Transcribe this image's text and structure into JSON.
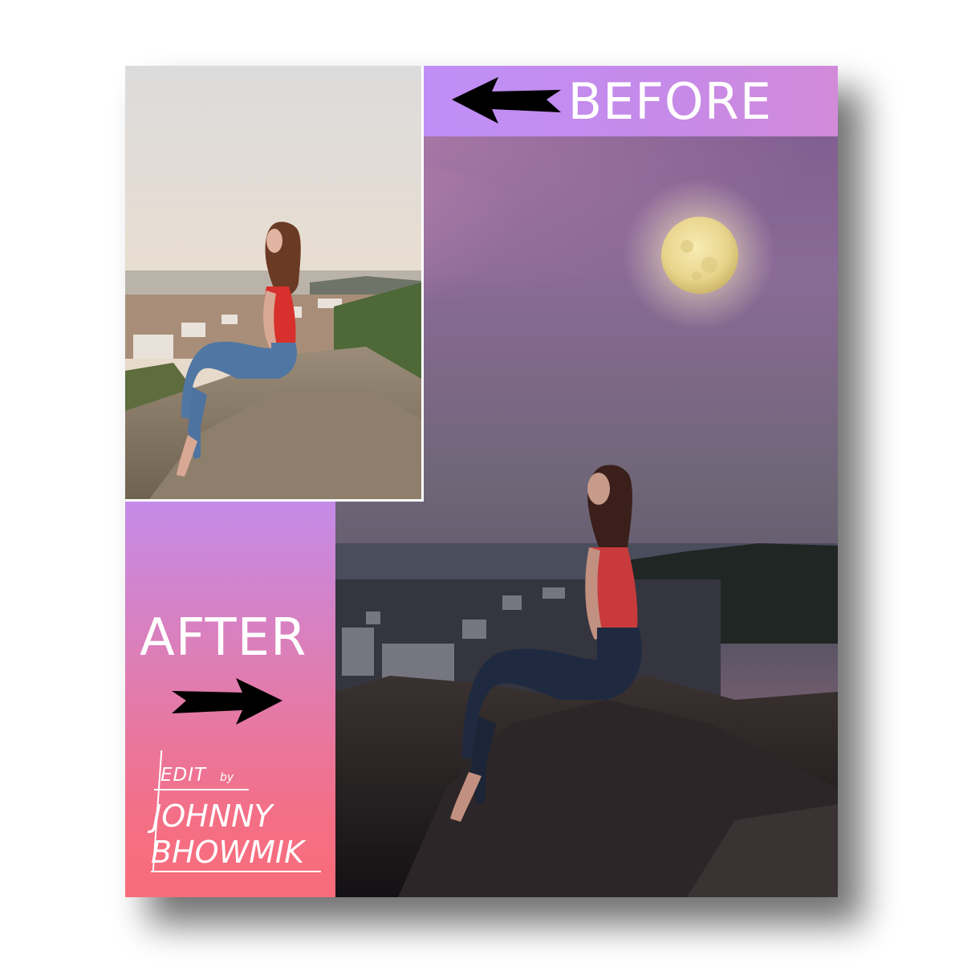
{
  "labels": {
    "before": "BEFORE",
    "after": "AFTER"
  },
  "credit": {
    "edit": "EDIT",
    "by": "by",
    "first_name": "JOHNNY",
    "last_name": "BHOWMIK"
  },
  "icons": {
    "before_arrow": "arrow-left-icon",
    "after_arrow": "arrow-right-icon"
  },
  "colors": {
    "before_banner_start": "#bf8ff7",
    "after_panel_top": "#c48be8",
    "after_panel_bottom": "#f86c7a",
    "text": "#ffffff",
    "arrow": "#000000"
  }
}
